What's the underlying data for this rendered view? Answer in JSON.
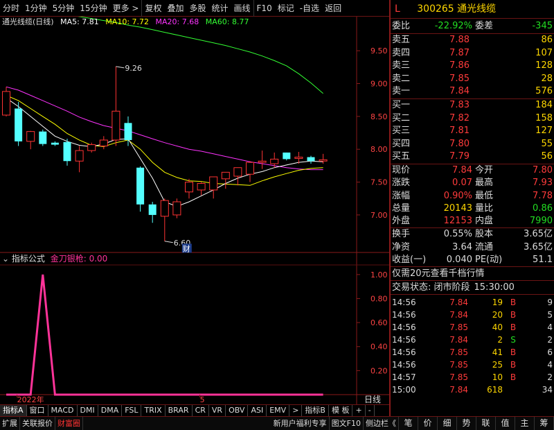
{
  "toolbar": {
    "items": [
      "分时",
      "1分钟",
      "5分钟",
      "15分钟",
      "更多 >",
      "复权",
      "叠加",
      "多股",
      "统计",
      "画线",
      "F10",
      "标记",
      "-自选",
      "返回"
    ]
  },
  "chart_header": {
    "title": "通光线缆(日线)",
    "ma5": "MA5: 7.81",
    "ma10": "MA10: 7.72",
    "ma20": "MA20: 7.68",
    "ma60": "MA60: 8.77",
    "colors": {
      "ma5": "#ffffff",
      "ma10": "#ffff00",
      "ma20": "#ff33ff",
      "ma60": "#33ff33"
    }
  },
  "indicator_header": {
    "label": "指标公式",
    "formula": "金刀银枪: 0.00"
  },
  "chart_data": [
    {
      "type": "candlestick",
      "title": "通光线缆(日线)",
      "y_ticks": [
        "9.50",
        "9.00",
        "8.50",
        "8.00",
        "7.50",
        "7.00"
      ],
      "ylim": [
        6.45,
        9.85
      ],
      "annotations": [
        {
          "text": "9.26",
          "value": 9.26
        },
        {
          "text": "6.60",
          "value": 6.6
        },
        {
          "text": "财",
          "value": 6.52
        }
      ],
      "candles": [
        {
          "o": 8.52,
          "h": 8.95,
          "l": 8.5,
          "c": 8.88
        },
        {
          "o": 8.62,
          "h": 8.72,
          "l": 8.05,
          "c": 8.12
        },
        {
          "o": 8.12,
          "h": 8.28,
          "l": 8.0,
          "c": 8.27
        },
        {
          "o": 8.27,
          "h": 8.3,
          "l": 8.05,
          "c": 8.08
        },
        {
          "o": 8.1,
          "h": 8.12,
          "l": 8.05,
          "c": 8.07
        },
        {
          "o": 8.11,
          "h": 8.16,
          "l": 7.75,
          "c": 7.82
        },
        {
          "o": 7.82,
          "h": 8.05,
          "l": 7.65,
          "c": 7.98
        },
        {
          "o": 7.98,
          "h": 8.1,
          "l": 7.95,
          "c": 8.07
        },
        {
          "o": 8.05,
          "h": 8.2,
          "l": 8.0,
          "c": 8.14
        },
        {
          "o": 8.14,
          "h": 9.26,
          "l": 8.05,
          "c": 8.58
        },
        {
          "o": 8.4,
          "h": 8.5,
          "l": 8.05,
          "c": 8.14
        },
        {
          "o": 7.72,
          "h": 7.74,
          "l": 7.05,
          "c": 7.16
        },
        {
          "o": 7.16,
          "h": 7.2,
          "l": 6.88,
          "c": 7.0
        },
        {
          "o": 6.98,
          "h": 7.25,
          "l": 6.6,
          "c": 7.22
        },
        {
          "o": 7.0,
          "h": 7.25,
          "l": 6.95,
          "c": 7.2
        },
        {
          "o": 7.35,
          "h": 7.55,
          "l": 7.25,
          "c": 7.5
        },
        {
          "o": 7.38,
          "h": 7.5,
          "l": 7.3,
          "c": 7.48
        },
        {
          "o": 7.38,
          "h": 7.55,
          "l": 7.25,
          "c": 7.58
        },
        {
          "o": 7.55,
          "h": 7.65,
          "l": 7.4,
          "c": 7.65
        },
        {
          "o": 7.59,
          "h": 7.62,
          "l": 7.45,
          "c": 7.72
        },
        {
          "o": 7.62,
          "h": 7.82,
          "l": 7.5,
          "c": 7.8
        },
        {
          "o": 7.8,
          "h": 7.98,
          "l": 7.7,
          "c": 7.82
        },
        {
          "o": 7.78,
          "h": 7.95,
          "l": 7.72,
          "c": 7.85
        },
        {
          "o": 7.95,
          "h": 7.95,
          "l": 7.83,
          "c": 7.85
        },
        {
          "o": 7.86,
          "h": 7.96,
          "l": 7.78,
          "c": 7.88
        },
        {
          "o": 7.88,
          "h": 7.9,
          "l": 7.78,
          "c": 7.82
        },
        {
          "o": 7.82,
          "h": 7.93,
          "l": 7.78,
          "c": 7.84
        }
      ],
      "ma_series": [
        {
          "name": "MA60",
          "color": "#33ff33",
          "values": [
            10.18,
            10.16,
            10.14,
            10.11,
            10.08,
            10.05,
            10.02,
            9.99,
            9.96,
            9.93,
            9.89,
            9.86,
            9.82,
            9.78,
            9.74,
            9.7,
            9.66,
            9.62,
            9.58,
            9.53,
            9.48,
            9.42,
            9.35,
            9.27,
            9.15,
            9.01,
            8.85
          ]
        },
        {
          "name": "MA20",
          "color": "#ff33ff",
          "values": [
            8.95,
            8.9,
            8.82,
            8.74,
            8.66,
            8.58,
            8.49,
            8.42,
            8.36,
            8.32,
            8.28,
            8.22,
            8.16,
            8.1,
            8.05,
            8.0,
            7.97,
            7.93,
            7.89,
            7.85,
            7.81,
            7.78,
            7.75,
            7.72,
            7.7,
            7.69,
            7.69
          ]
        },
        {
          "name": "MA10",
          "color": "#ffff00",
          "values": [
            8.82,
            8.74,
            8.62,
            8.5,
            8.38,
            8.24,
            8.14,
            8.06,
            8.04,
            8.1,
            8.14,
            8.0,
            7.8,
            7.65,
            7.57,
            7.52,
            7.51,
            7.48,
            7.47,
            7.46,
            7.45,
            7.52,
            7.58,
            7.63,
            7.68,
            7.71,
            7.72
          ]
        },
        {
          "name": "MA5",
          "color": "#ffffff",
          "values": [
            8.78,
            8.65,
            8.5,
            8.35,
            8.2,
            8.12,
            8.06,
            8.04,
            8.08,
            8.15,
            8.16,
            7.86,
            7.56,
            7.2,
            7.13,
            7.2,
            7.29,
            7.38,
            7.48,
            7.56,
            7.62,
            7.66,
            7.72,
            7.76,
            7.8,
            7.82,
            7.81
          ]
        }
      ]
    },
    {
      "type": "line",
      "title": "金刀银枪",
      "y_ticks": [
        "1.00",
        "0.80",
        "0.60",
        "0.40",
        "0.20"
      ],
      "ylim": [
        0,
        1.08
      ],
      "values": [
        0,
        0,
        0,
        1,
        0,
        0,
        0,
        0,
        0,
        0,
        0,
        0,
        0,
        0,
        0,
        0,
        0,
        0,
        0,
        0,
        0,
        0,
        0,
        0,
        0,
        0,
        0
      ],
      "x_labels": [
        {
          "text": "2022年",
          "index": 1
        },
        {
          "text": "5",
          "index": 16
        }
      ],
      "x_end_label": "日线"
    }
  ],
  "bottom_tabs": [
    "指标A",
    "窗口",
    "MACD",
    "DMI",
    "DMA",
    "FSL",
    "TRIX",
    "BRAR",
    "CR",
    "VR",
    "OBV",
    "ASI",
    "EMV",
    ">",
    "指标B",
    "模 板",
    "+",
    "-"
  ],
  "status_bar": {
    "left": [
      "扩展",
      "关联报价",
      "财富圈"
    ],
    "mid": [
      "新用户福利专享",
      "图文F10",
      "侧边栏《"
    ],
    "icons": [
      "笔",
      "价",
      "细",
      "势",
      "联",
      "值",
      "主",
      "筹"
    ]
  },
  "quote": {
    "flag": "L",
    "code": "300265",
    "name": "通光线缆",
    "weibi_label": "委比",
    "weibi": "-22.92%",
    "weicha_label": "委差",
    "weicha": "-345",
    "asks": [
      {
        "label": "卖五",
        "price": "7.88",
        "vol": "86"
      },
      {
        "label": "卖四",
        "price": "7.87",
        "vol": "107"
      },
      {
        "label": "卖三",
        "price": "7.86",
        "vol": "128"
      },
      {
        "label": "卖二",
        "price": "7.85",
        "vol": "28"
      },
      {
        "label": "卖一",
        "price": "7.84",
        "vol": "576"
      }
    ],
    "bids": [
      {
        "label": "买一",
        "price": "7.83",
        "vol": "184"
      },
      {
        "label": "买二",
        "price": "7.82",
        "vol": "158"
      },
      {
        "label": "买三",
        "price": "7.81",
        "vol": "127"
      },
      {
        "label": "买四",
        "price": "7.80",
        "vol": "55"
      },
      {
        "label": "买五",
        "price": "7.79",
        "vol": "56"
      }
    ],
    "stats": [
      {
        "l1": "现价",
        "v1": "7.84",
        "c1": "red",
        "l2": "今开",
        "v2": "7.80",
        "c2": "red"
      },
      {
        "l1": "涨跌",
        "v1": "0.07",
        "c1": "red",
        "l2": "最高",
        "v2": "7.93",
        "c2": "red"
      },
      {
        "l1": "涨幅",
        "v1": "0.90%",
        "c1": "red",
        "l2": "最低",
        "v2": "7.78",
        "c2": "red"
      },
      {
        "l1": "总量",
        "v1": "20143",
        "c1": "yellow",
        "l2": "量比",
        "v2": "0.86",
        "c2": "green"
      },
      {
        "l1": "外盘",
        "v1": "12153",
        "c1": "red",
        "l2": "内盘",
        "v2": "7990",
        "c2": "green"
      }
    ],
    "stats2": [
      {
        "l1": "换手",
        "v1": "0.55%",
        "l2": "股本",
        "v2": "3.65亿"
      },
      {
        "l1": "净资",
        "v1": "3.64",
        "l2": "流通",
        "v2": "3.65亿"
      },
      {
        "l1": "收益(一)",
        "v1": "0.040",
        "l2": "PE(动)",
        "v2": "51.1"
      }
    ],
    "promo": "仅需20元查看千档行情",
    "trade_status_label": "交易状态: 闭市阶段",
    "trade_status_time": "15:30:00",
    "trades": [
      {
        "t": "14:56",
        "p": "7.84",
        "v": "19",
        "d": "B",
        "n": "9"
      },
      {
        "t": "14:56",
        "p": "7.84",
        "v": "20",
        "d": "B",
        "n": "5"
      },
      {
        "t": "14:56",
        "p": "7.85",
        "v": "40",
        "d": "B",
        "n": "4"
      },
      {
        "t": "14:56",
        "p": "7.84",
        "v": "2",
        "d": "S",
        "n": "2"
      },
      {
        "t": "14:56",
        "p": "7.85",
        "v": "41",
        "d": "B",
        "n": "6"
      },
      {
        "t": "14:56",
        "p": "7.85",
        "v": "25",
        "d": "B",
        "n": "4"
      },
      {
        "t": "14:57",
        "p": "7.85",
        "v": "10",
        "d": "B",
        "n": "2"
      },
      {
        "t": "15:00",
        "p": "7.84",
        "v": "618",
        "d": "",
        "n": "34"
      }
    ]
  }
}
